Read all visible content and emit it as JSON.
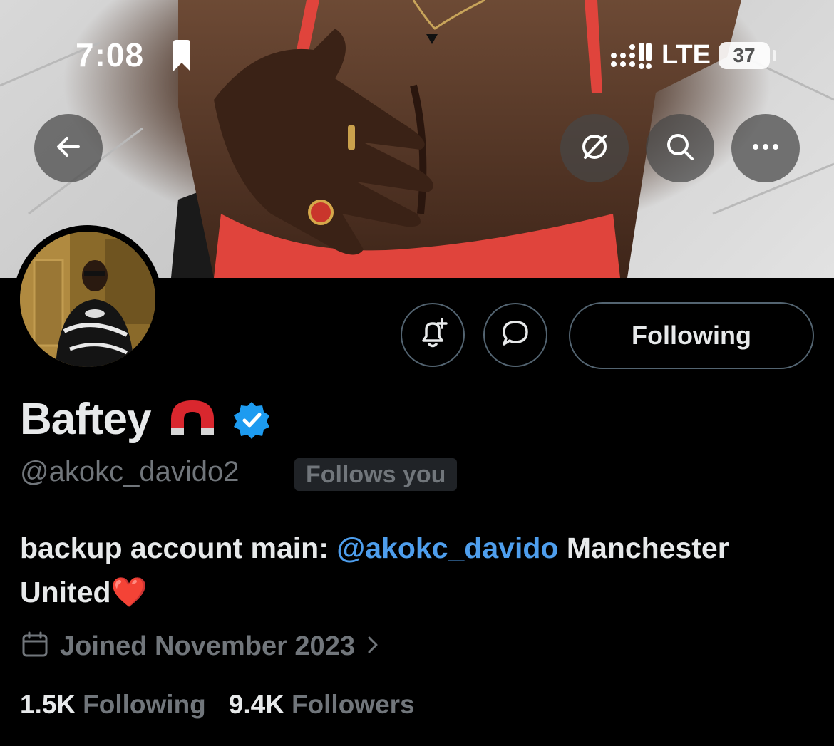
{
  "status_bar": {
    "time": "7:08",
    "network": "LTE",
    "battery": "37"
  },
  "header": {
    "back_icon": "arrow-left-icon",
    "actions": [
      {
        "name": "grok-icon"
      },
      {
        "name": "search-icon"
      },
      {
        "name": "more-icon"
      }
    ]
  },
  "profile": {
    "display_name": "Baftey",
    "name_emoji": "magnet-emoji",
    "verified": true,
    "handle": "@akokc_davido2",
    "follows_you_label": "Follows you",
    "bio": {
      "text_before": "backup account main: ",
      "mention": "@akokc_davido",
      "text_after": " Manchester United",
      "emoji": "❤️"
    },
    "joined": "Joined November 2023",
    "following_count": "1.5K",
    "following_label": "Following",
    "followers_count": "9.4K",
    "followers_label": "Followers"
  },
  "actions": {
    "notify_icon": "bell-plus-icon",
    "message_icon": "message-bubble-icon",
    "following_button": "Following"
  },
  "colors": {
    "background": "#000000",
    "text_primary": "#e7e9ea",
    "text_secondary": "#71767b",
    "link": "#4e9eed",
    "verified": "#1d9bf0",
    "heart": "#e0242a"
  }
}
